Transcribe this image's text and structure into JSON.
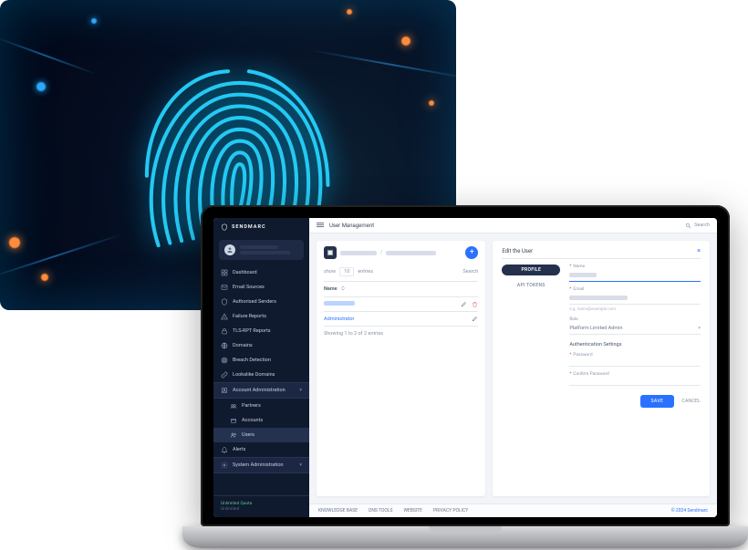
{
  "brand": "SENDMARC",
  "header": {
    "title": "User Management",
    "search_label": "Search"
  },
  "sidebar": {
    "items": [
      {
        "icon": "dashboard",
        "label": "Dashboard"
      },
      {
        "icon": "email",
        "label": "Email Sources"
      },
      {
        "icon": "shield",
        "label": "Authorised Senders"
      },
      {
        "icon": "warning",
        "label": "Failure Reports"
      },
      {
        "icon": "lock",
        "label": "TLS-RPT Reports"
      },
      {
        "icon": "globe",
        "label": "Domains"
      },
      {
        "icon": "radar",
        "label": "Breach Detection"
      },
      {
        "icon": "link",
        "label": "Lookalike Domains"
      },
      {
        "icon": "admin",
        "label": "Account Administration",
        "expandable": true
      },
      {
        "icon": "partner",
        "label": "Partners",
        "child": true
      },
      {
        "icon": "account",
        "label": "Accounts",
        "child": true
      },
      {
        "icon": "users",
        "label": "Users",
        "child": true,
        "active": true
      },
      {
        "icon": "bell",
        "label": "Alerts"
      },
      {
        "icon": "gear",
        "label": "System Administration",
        "expandable": true
      }
    ],
    "quota_label": "Unlimited Quota",
    "quota_sub": "Unlimited"
  },
  "list": {
    "show_prefix": "show",
    "show_count": "10",
    "show_suffix": "entries",
    "search_label": "Search",
    "col_name": "Name",
    "rows": [
      {
        "name": "",
        "redacted": true
      },
      {
        "name": "Administrator"
      }
    ],
    "paging": "Showing 1 to 2 of 2 entries"
  },
  "editor": {
    "title": "Edit the User",
    "tabs": [
      {
        "label": "PROFILE",
        "active": true
      },
      {
        "label": "API TOKENS"
      }
    ],
    "fields": {
      "name": {
        "label": "Name",
        "required": true,
        "value": ""
      },
      "email": {
        "label": "Email",
        "required": true,
        "value": "",
        "hint": "e.g. name@example.com"
      },
      "role": {
        "label": "Role",
        "value": "Platform Limited Admin"
      },
      "auth_section": "Authentication Settings",
      "password": {
        "label": "Password",
        "required": true
      },
      "confirm": {
        "label": "Confirm Password",
        "required": true
      }
    },
    "save": "SAVE",
    "cancel": "CANCEL"
  },
  "footer": {
    "links": [
      "KNOWLEDGE BASE",
      "DNS TOOLS",
      "WEBSITE",
      "PRIVACY POLICY"
    ],
    "copyright": "© 2024 Sendmarc"
  }
}
